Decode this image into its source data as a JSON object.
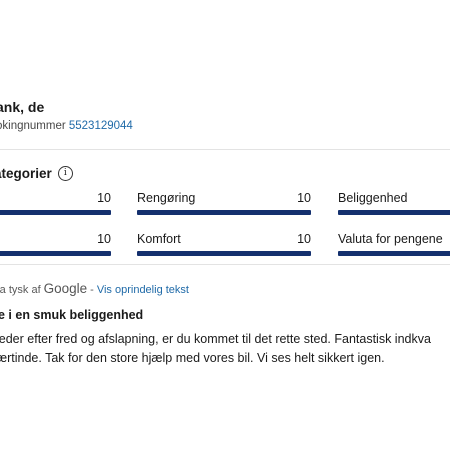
{
  "reviewer": {
    "name": "ank, de",
    "booking_label": "okingnummer",
    "booking_number": "5523129044"
  },
  "categories": {
    "title": "ategorier",
    "info_icon": "info-icon",
    "items": [
      {
        "label": "",
        "score": "10",
        "fill": 1.0
      },
      {
        "label": "Rengøring",
        "score": "10",
        "fill": 1.0
      },
      {
        "label": "Beliggenhed",
        "score": "",
        "fill": 1.0
      },
      {
        "label": "",
        "score": "10",
        "fill": 1.0
      },
      {
        "label": "Komfort",
        "score": "10",
        "fill": 1.0
      },
      {
        "label": "Valuta for pengene",
        "score": "",
        "fill": 1.0
      }
    ],
    "bar_color": "#14306e"
  },
  "translation": {
    "prefix": "ra tysk af",
    "provider": "Google",
    "separator": "-",
    "show_original": "Vis oprindelig tekst"
  },
  "review": {
    "title": "e i en smuk beliggenhed",
    "line1": "leder efter fred og afslapning, er du kommet til det rette sted. Fantastisk indkva",
    "line2": "ærtinde. Tak for den store hjælp med vores bil. Vi ses helt sikkert igen."
  }
}
